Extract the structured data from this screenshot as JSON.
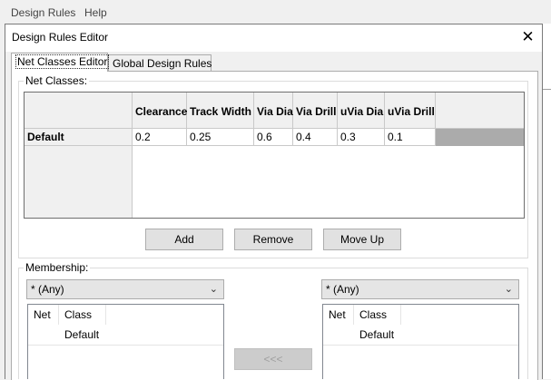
{
  "menubar": {
    "items": [
      {
        "label": "Design Rules"
      },
      {
        "label": "Help"
      }
    ]
  },
  "dialog": {
    "title": "Design Rules Editor",
    "close_symbol": "✕"
  },
  "tabs": [
    {
      "label": "Net Classes Editor",
      "active": true
    },
    {
      "label": "Global Design Rules",
      "active": false
    }
  ],
  "net_classes": {
    "group_label": "Net Classes:",
    "columns": [
      "Clearance",
      "Track Width",
      "Via Dia",
      "Via Drill",
      "uVia Dia",
      "uVia Drill"
    ],
    "rows": [
      {
        "name": "Default",
        "values": [
          "0.2",
          "0.25",
          "0.6",
          "0.4",
          "0.3",
          "0.1"
        ]
      }
    ],
    "buttons": {
      "add": "Add",
      "remove": "Remove",
      "move_up": "Move Up"
    }
  },
  "membership": {
    "group_label": "Membership:",
    "left_filter": "* (Any)",
    "right_filter": "* (Any)",
    "left_list": {
      "col_net": "Net",
      "col_class": "Class",
      "rows": [
        {
          "net": "",
          "class": "Default"
        }
      ]
    },
    "right_list": {
      "col_net": "Net",
      "col_class": "Class",
      "rows": [
        {
          "net": "",
          "class": "Default"
        }
      ]
    },
    "move_left_button": "<<<"
  },
  "colors": {
    "window_bg": "#f0f0f0",
    "panel_bg": "#ffffff",
    "grid_bg": "#ababab",
    "button_bg": "#e1e1e1"
  }
}
